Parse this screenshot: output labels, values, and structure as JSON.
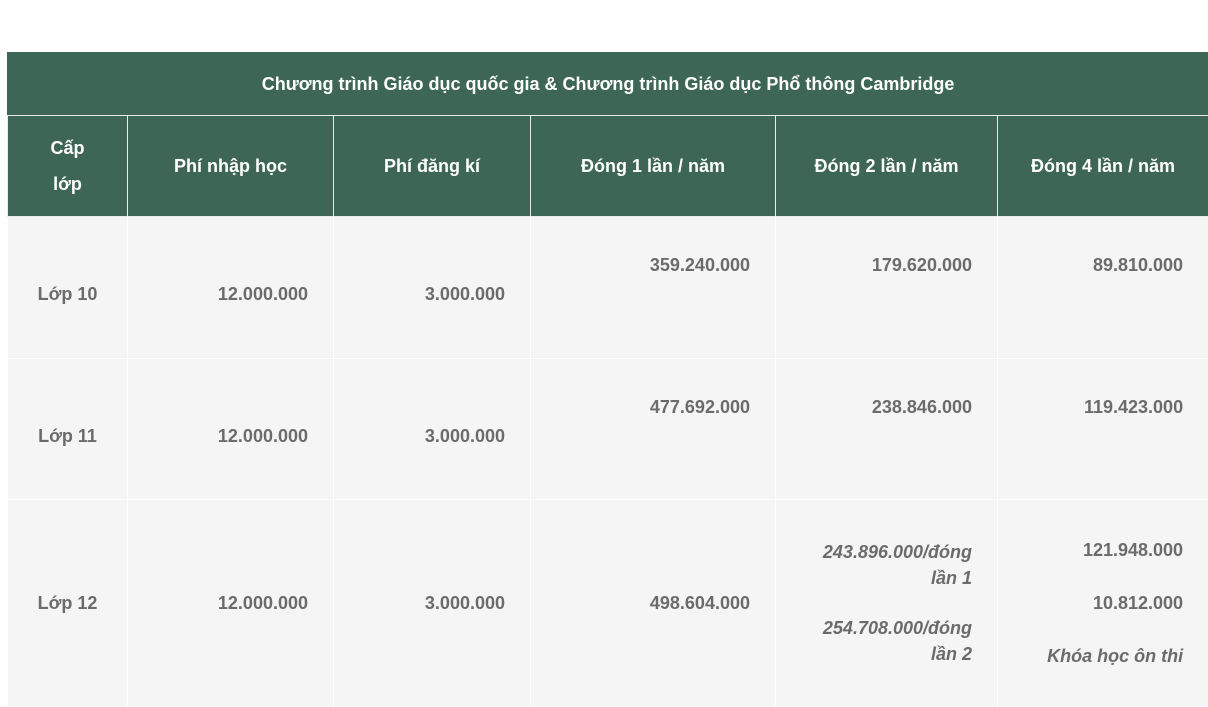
{
  "table": {
    "title": "Chương trình Giáo dục quốc gia & Chương trình Giáo dục Phổ thông Cambridge",
    "headers": {
      "grade_line1": "Cấp",
      "grade_line2": "lớp",
      "admission_fee": "Phí nhập học",
      "registration_fee": "Phí đăng kí",
      "pay_once": "Đóng 1 lần / năm",
      "pay_twice": "Đóng 2 lần / năm",
      "pay_four": "Đóng 4 lần / năm"
    },
    "rows": [
      {
        "grade": "Lớp 10",
        "admission_fee": "12.000.000",
        "registration_fee": "3.000.000",
        "pay_once": "359.240.000",
        "pay_twice": "179.620.000",
        "pay_four": "89.810.000"
      },
      {
        "grade": "Lớp 11",
        "admission_fee": "12.000.000",
        "registration_fee": "3.000.000",
        "pay_once": "477.692.000",
        "pay_twice": "238.846.000",
        "pay_four": "119.423.000"
      },
      {
        "grade": "Lớp 12",
        "admission_fee": "12.000.000",
        "registration_fee": "3.000.000",
        "pay_once": "498.604.000",
        "pay_twice_1_line1": "243.896.000/đóng",
        "pay_twice_1_line2": "lần 1",
        "pay_twice_2_line1": "254.708.000/đóng",
        "pay_twice_2_line2": "lần 2",
        "pay_four_1": "121.948.000",
        "pay_four_2": "10.812.000",
        "pay_four_note": "Khóa học ôn thi"
      }
    ]
  }
}
